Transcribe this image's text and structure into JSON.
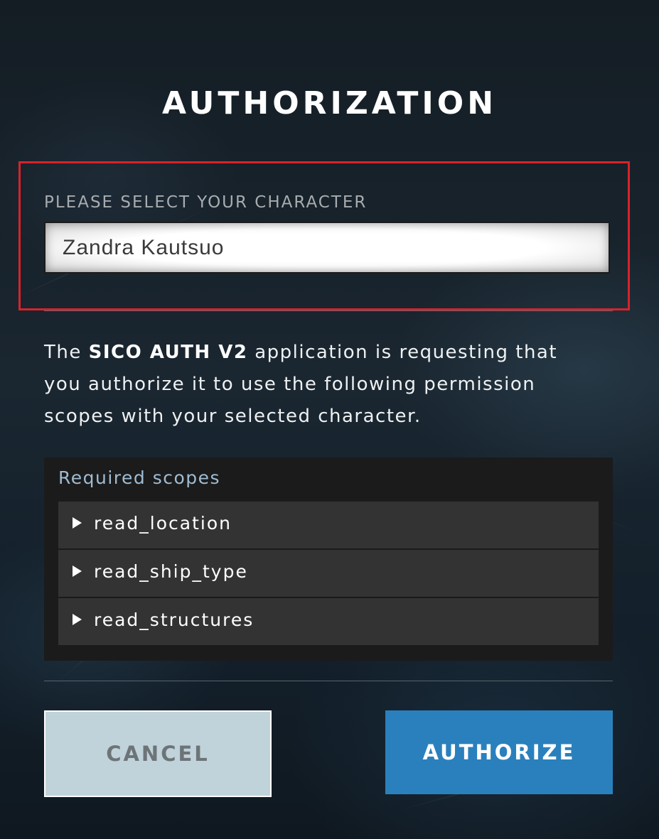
{
  "page": {
    "title": "AUTHORIZATION"
  },
  "character_select": {
    "label": "PLEASE SELECT YOUR CHARACTER",
    "value": "Zandra Kautsuo",
    "highlight_color": "#d9222a"
  },
  "description": {
    "prefix": "The ",
    "app_name": "SICO AUTH V2",
    "suffix": " application is requesting that you authorize it to use the following permission scopes with your selected character."
  },
  "scopes": {
    "title": "Required scopes",
    "items": [
      {
        "label": "read_location",
        "icon": "expand-arrow-icon"
      },
      {
        "label": "read_ship_type",
        "icon": "expand-arrow-icon"
      },
      {
        "label": "read_structures",
        "icon": "expand-arrow-icon"
      }
    ]
  },
  "actions": {
    "cancel_label": "CANCEL",
    "authorize_label": "AUTHORIZE",
    "authorize_color": "#2a80bd"
  }
}
